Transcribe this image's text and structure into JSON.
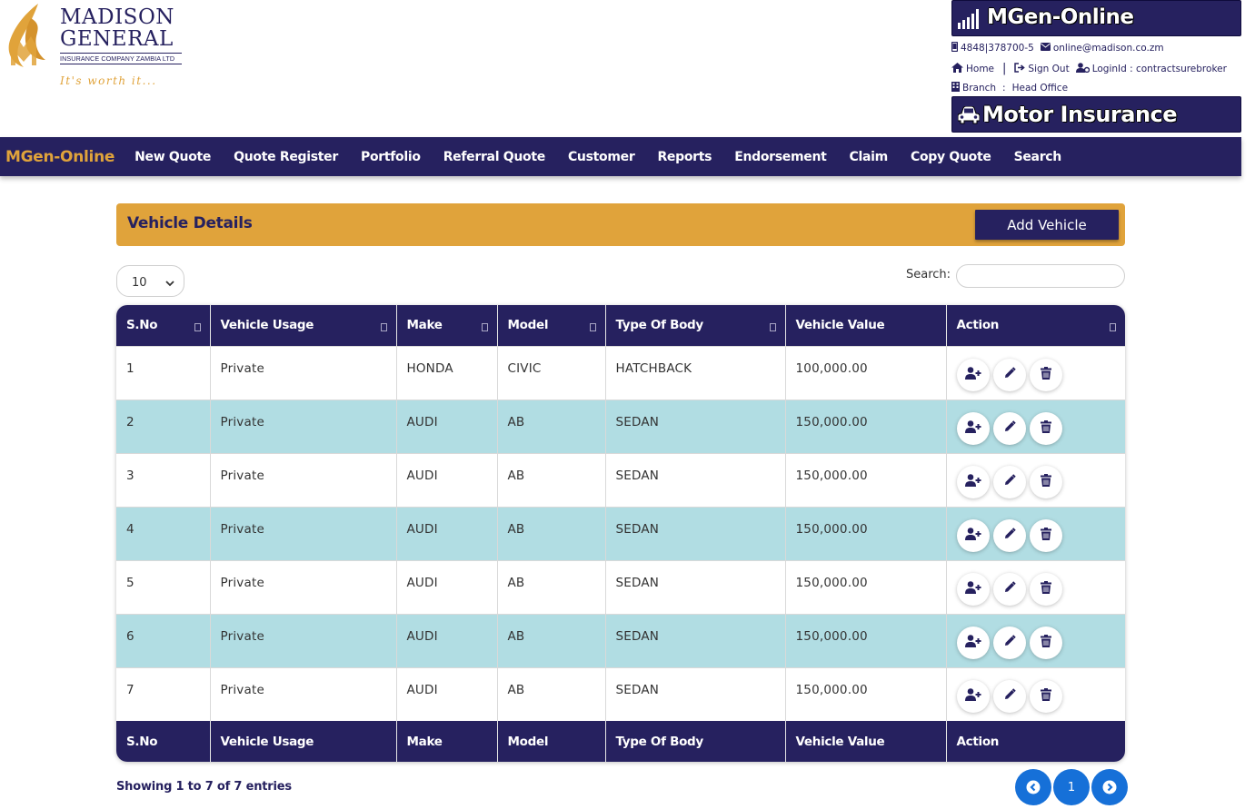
{
  "logo": {
    "line1": "MADISON",
    "line2": "GENERAL",
    "sub": "INSURANCE COMPANY ZAMBIA LTD",
    "tagline": "It's worth it..."
  },
  "header": {
    "brand": "MGen-Online",
    "phone": "4848|378700-5",
    "email": "online@madison.co.zm",
    "home": "Home",
    "sign_out": "Sign Out",
    "login": "LoginId : contractsurebroker",
    "branch_label": "Branch",
    "branch_sep": ":",
    "branch_value": "Head Office",
    "product": "Motor Insurance"
  },
  "nav": {
    "brand": "MGen-Online",
    "items": [
      "New Quote",
      "Quote Register",
      "Portfolio",
      "Referral Quote",
      "Customer",
      "Reports",
      "Endorsement",
      "Claim",
      "Copy Quote",
      "Search"
    ]
  },
  "panel": {
    "title": "Vehicle Details",
    "add_button": "Add Vehicle"
  },
  "table_controls": {
    "page_length": "10",
    "search_label": "Search:",
    "search_value": ""
  },
  "table": {
    "columns": [
      "S.No",
      "Vehicle Usage",
      "Make",
      "Model",
      "Type Of Body",
      "Vehicle Value",
      "Action"
    ],
    "rows": [
      [
        "1",
        "Private",
        "HONDA",
        "CIVIC",
        "HATCHBACK",
        "100,000.00"
      ],
      [
        "2",
        "Private",
        "AUDI",
        "AB",
        "SEDAN",
        "150,000.00"
      ],
      [
        "3",
        "Private",
        "AUDI",
        "AB",
        "SEDAN",
        "150,000.00"
      ],
      [
        "4",
        "Private",
        "AUDI",
        "AB",
        "SEDAN",
        "150,000.00"
      ],
      [
        "5",
        "Private",
        "AUDI",
        "AB",
        "SEDAN",
        "150,000.00"
      ],
      [
        "6",
        "Private",
        "AUDI",
        "AB",
        "SEDAN",
        "150,000.00"
      ],
      [
        "7",
        "Private",
        "AUDI",
        "AB",
        "SEDAN",
        "150,000.00"
      ]
    ]
  },
  "footer": {
    "info": "Showing 1 to 7 of 7 entries",
    "current_page": "1"
  },
  "colors": {
    "navy": "#26215f",
    "gold": "#e0a33b",
    "row_alt": "#b1dde3",
    "pager": "#1670d8"
  },
  "icons": {
    "brand": "signal-bars-icon",
    "phone": "mobile-phone-icon",
    "email": "envelope-icon",
    "home": "home-icon",
    "sign_out": "sign-out-icon",
    "login": "user-gear-icon",
    "branch": "building-icon",
    "product": "car-icon",
    "row_actions": [
      "add-user-icon",
      "pencil-icon",
      "trash-icon"
    ],
    "pager": [
      "chevron-left-icon",
      "chevron-right-icon"
    ]
  }
}
